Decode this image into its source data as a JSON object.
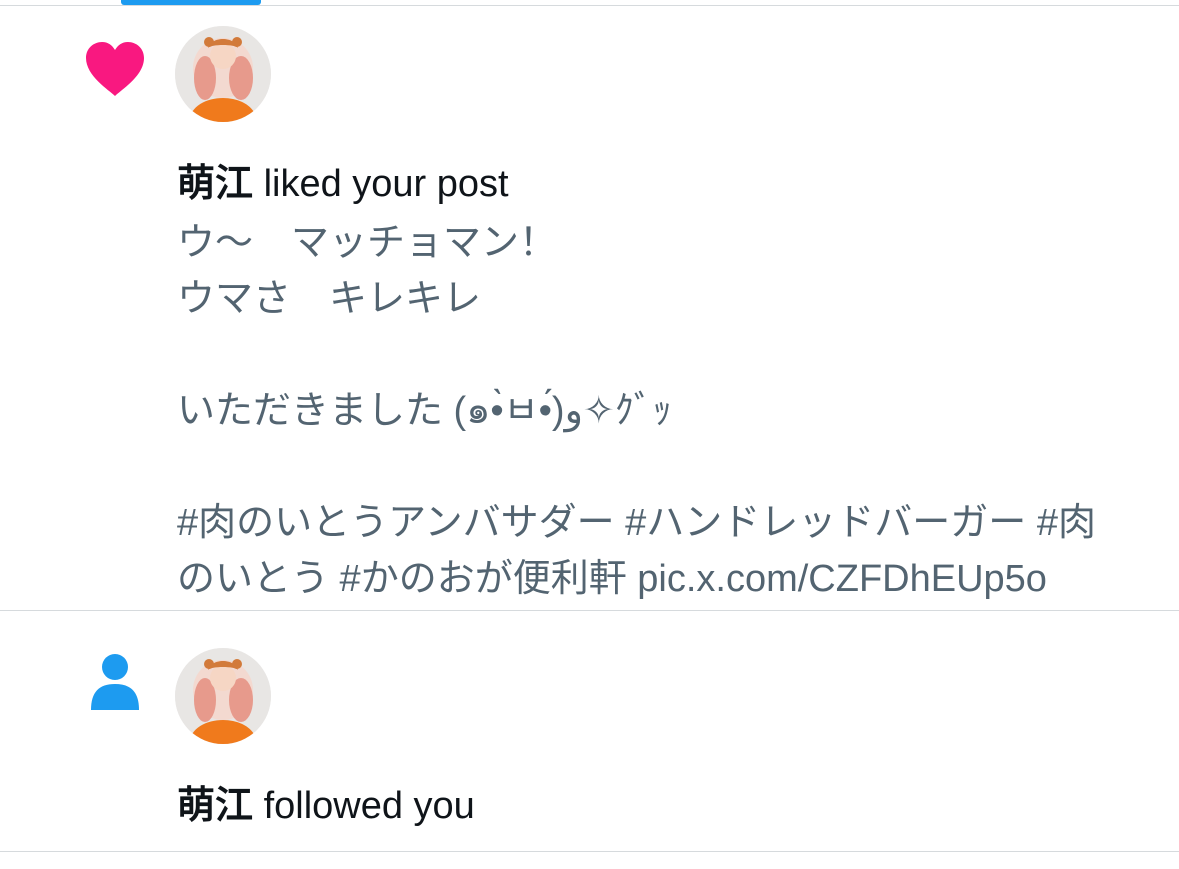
{
  "colors": {
    "accent": "#1d9bf0",
    "like": "#f91880",
    "text": "#0f1419",
    "secondary": "#536471",
    "divider": "#d6dadd"
  },
  "notifications": [
    {
      "type": "like",
      "icon": "heart-icon",
      "user": "萌江",
      "action": " liked your post",
      "post_lines": [
        "ウ〜　マッチョマン！",
        "ウマさ　キレキレ",
        "",
        "いただきました (๑•̀ㅂ•́)و✧ｸﾞｯ",
        "",
        "#肉のいとうアンバサダー #ハンドレッドバーガー #肉",
        "のいとう #かのおが便利軒 pic.x.com/CZFDhEUp5o"
      ]
    },
    {
      "type": "follow",
      "icon": "person-icon",
      "user": "萌江",
      "action": " followed you"
    }
  ]
}
